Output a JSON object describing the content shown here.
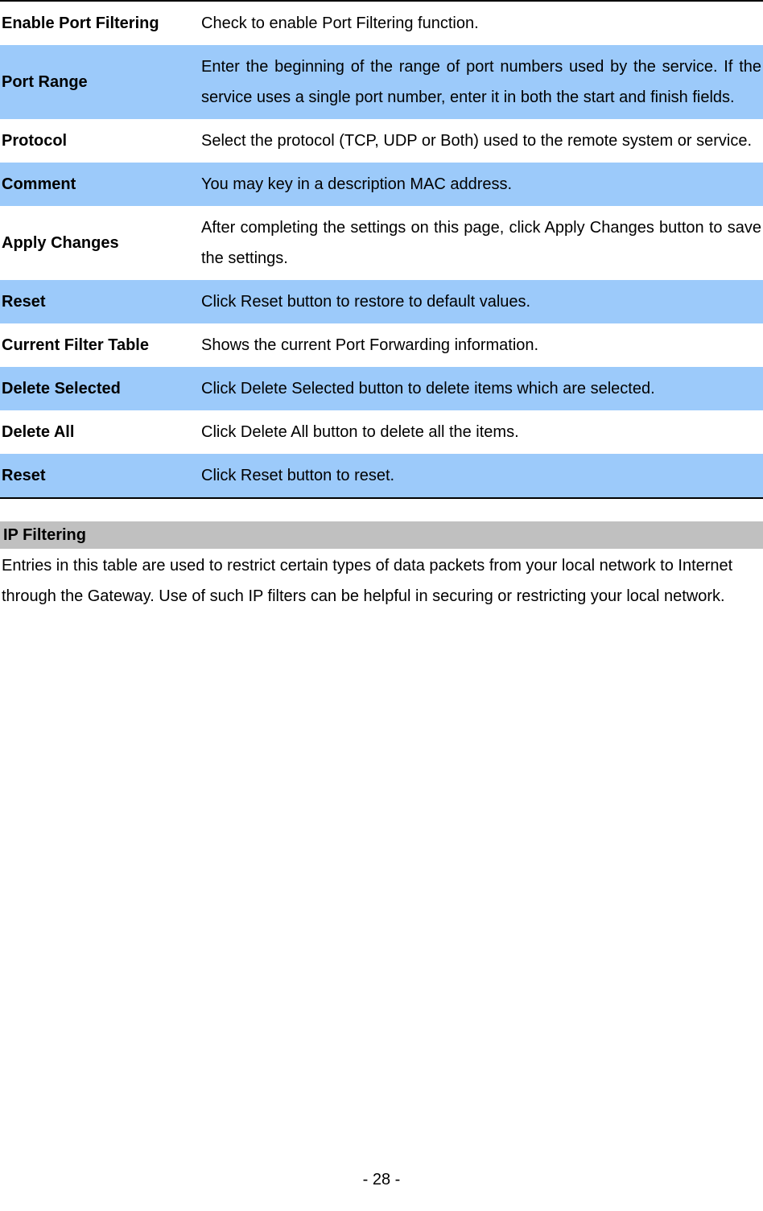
{
  "table": {
    "rows": [
      {
        "label": "Enable Port Filtering",
        "desc": "Check to enable Port Filtering function.",
        "shade": false
      },
      {
        "label": "Port Range",
        "desc": "Enter the beginning of the range of port numbers used by the service. If the service uses a single port number, enter it in both the start and finish fields.",
        "shade": true
      },
      {
        "label": "Protocol",
        "desc": "Select the protocol (TCP, UDP or Both) used to the remote system or service.",
        "shade": false
      },
      {
        "label": "Comment",
        "desc": "You may key in a description MAC address.",
        "shade": true
      },
      {
        "label": "Apply Changes",
        "desc": "After completing the settings on this page, click Apply Changes button to save the settings.",
        "shade": false
      },
      {
        "label": "Reset",
        "desc": "Click Reset button to restore to default values.",
        "shade": true
      },
      {
        "label": "Current Filter Table",
        "desc": "Shows the current Port Forwarding information.",
        "shade": false
      },
      {
        "label": "Delete Selected",
        "desc": "Click Delete Selected button to delete items which are selected.",
        "shade": true
      },
      {
        "label": "Delete All",
        "desc": "Click Delete All button to delete all the items.",
        "shade": false
      },
      {
        "label": "Reset",
        "desc": "Click Reset button to reset.",
        "shade": true
      }
    ]
  },
  "section": {
    "title": "IP Filtering",
    "body": "Entries in this table are used to restrict certain types of data packets from your local network to Internet through the Gateway. Use of such IP filters can be helpful in securing or restricting your local network."
  },
  "page_number": "- 28 -"
}
